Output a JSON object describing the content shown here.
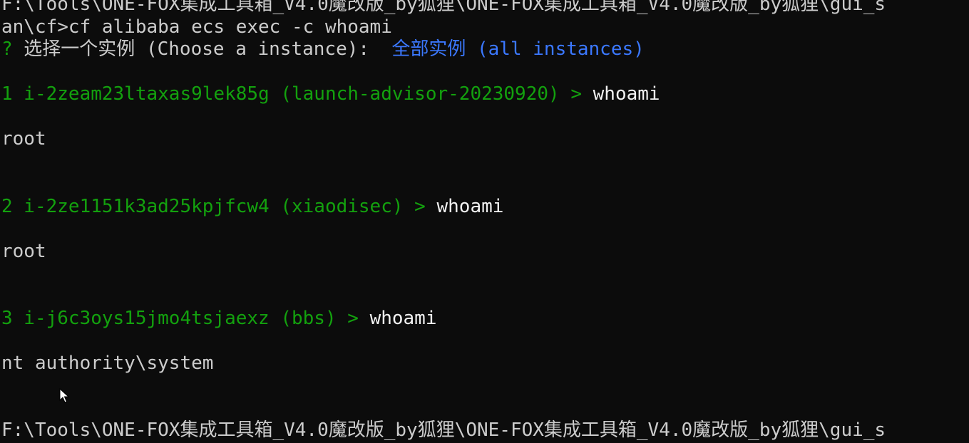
{
  "terminal": {
    "path_line_top": "F:\\Tools\\ONE-FOX集成工具箱_V4.0魔改版_by狐狸\\ONE-FOX集成工具箱_V4.0魔改版_by狐狸\\gui_s",
    "command": "an\\cf>cf alibaba ecs exec -c whoami",
    "prompt": {
      "mark": "?",
      "question": " 选择一个实例 (Choose a instance): ",
      "answer": " 全部实例 (all instances)"
    },
    "results": [
      {
        "instance": "1 i-2zeam23ltaxas9lek85g (launch-advisor-20230920) > ",
        "command": "whoami",
        "output": "root"
      },
      {
        "instance": "2 i-2ze1151k3ad25kpjfcw4 (xiaodisec) > ",
        "command": "whoami",
        "output": "root"
      },
      {
        "instance": "3 i-j6c3oys15jmo4tsjaexz (bbs) > ",
        "command": "whoami",
        "output": "nt authority\\system"
      }
    ],
    "path_line_bottom": "F:\\Tools\\ONE-FOX集成工具箱_V4.0魔改版_by狐狸\\ONE-FOX集成工具箱_V4.0魔改版_by狐狸\\gui_s"
  },
  "icons": {
    "cursor": "mouse-pointer-icon"
  },
  "colors": {
    "background": "#0c0c0c",
    "text": "#cccccc",
    "instance": "#13a10e",
    "answer": "#3b78ff",
    "command": "#f2f2f2"
  }
}
